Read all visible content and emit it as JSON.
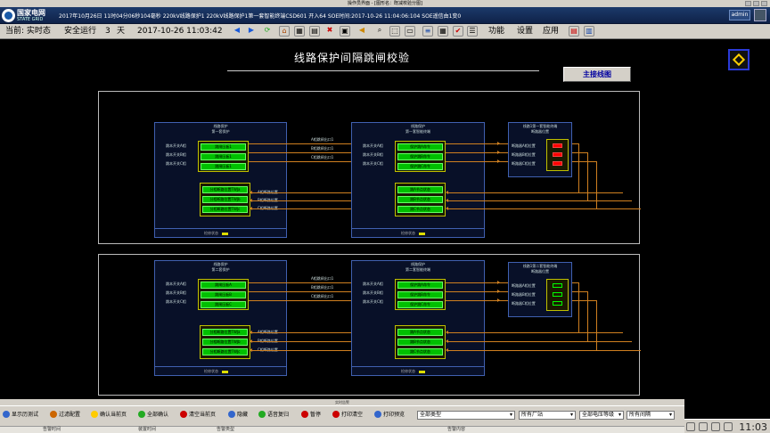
{
  "window": {
    "title": "操作员界面 - [图形名：既减校验分图]"
  },
  "alarm": {
    "logo_cn": "国家电网",
    "logo_en": "STATE GRID",
    "message": "2017年10月26日  11时04分06秒104毫秒    220kV线路保护1  220kV线路保护1第一套智能终端CSD601  开入64   SOE时间:2017-10-26  11:04:06:104  SOE遥信由1变0",
    "user": "admin"
  },
  "toolbar": {
    "current_label": "当前: 实时态",
    "mode": "安全运行",
    "days_value": "3",
    "days_unit": "天",
    "datetime": "2017-10-26 11:03:42",
    "menus": [
      "功能",
      "设置",
      "应用"
    ]
  },
  "main": {
    "title": "线路保护间隔跳闸校验",
    "main_button": "主接线图"
  },
  "panel1": {
    "dev1_title": "线路保护\n第一套保护",
    "dev1_inputs": [
      "跳本开关A相",
      "跳本开关B相",
      "跳本开关C相"
    ],
    "dev1_buttons": [
      "跳闸压板1",
      "跳闸压板1",
      "跳闸压板1"
    ],
    "dev1_pos_buttons": [
      "分相断路位置TWJa",
      "分相断路位置TWJb",
      "分相断路位置TWJc"
    ],
    "dev1_footer": "检修状态",
    "mid_labels": [
      "A相跳闸出口1",
      "B相跳闸出口1",
      "C相跳闸出口1"
    ],
    "back_labels": [
      "A相断路位置",
      "B相断路位置",
      "C相断路位置"
    ],
    "dev2_title": "线路保护\n第一套智能终端",
    "dev2_inputs": [
      "跳本开关A相",
      "跳本开关B相",
      "跳本开关C相"
    ],
    "dev2_buttons": [
      "保护跳A命令",
      "保护跳B命令",
      "保护跳C命令"
    ],
    "dev2_pos_buttons": [
      "跳A节点状态",
      "跳B节点状态",
      "跳C节点状态"
    ],
    "dev2_footer": "检修状态",
    "dev3_title": "线路1第一套智能终端\n断路器位置",
    "dev3_labels": [
      "断路器A相位置",
      "断路器B相位置",
      "断路器C相位置"
    ],
    "dev3_state": [
      "red",
      "red",
      "red"
    ]
  },
  "panel2": {
    "dev1_title": "线路保护\n第二套保护",
    "dev1_inputs": [
      "跳本开关A相",
      "跳本开关B相",
      "跳本开关C相"
    ],
    "dev1_buttons": [
      "跳闸压板A",
      "跳闸压板B",
      "跳闸压板C"
    ],
    "dev1_pos_buttons": [
      "分相断路位置TWJa",
      "分相断路位置TWJb",
      "分相断路位置TWJc"
    ],
    "dev1_footer": "检修状态",
    "mid_labels": [
      "A相跳闸出口1",
      "B相跳闸出口1",
      "C相跳闸出口1"
    ],
    "back_labels": [
      "A相断路位置",
      "B相断路位置",
      "C相断路位置"
    ],
    "dev2_title": "线路保护\n第二套智能终端",
    "dev2_inputs": [
      "跳本开关A相",
      "跳本开关B相",
      "跳本开关C相"
    ],
    "dev2_buttons": [
      "保护跳A命令",
      "保护跳B命令",
      "保护跳C命令"
    ],
    "dev2_pos_buttons": [
      "跳A节点状态",
      "跳B节点状态",
      "跳C节点状态"
    ],
    "dev2_footer": "检修状态",
    "dev3_title": "线路1第二套智能终端\n断路器位置",
    "dev3_labels": [
      "断路器A相位置",
      "断路器B相位置",
      "断路器C相位置"
    ],
    "dev3_state": [
      "green",
      "green",
      "green"
    ]
  },
  "bottom": {
    "title": "实时告警",
    "buttons": [
      "显示历测试",
      "过滤配置",
      "确认当前页",
      "全部确认",
      "清空当前页",
      "隐藏",
      "语音复归",
      "暂停",
      "打印清空",
      "打印预览"
    ],
    "selects": [
      "全部类型",
      "所有厂站",
      "全部电压等级",
      "所有间隔"
    ],
    "headers": [
      "告警时间",
      "装置时间",
      "告警类型",
      "告警内容"
    ]
  },
  "tray": {
    "time": "11:03"
  }
}
